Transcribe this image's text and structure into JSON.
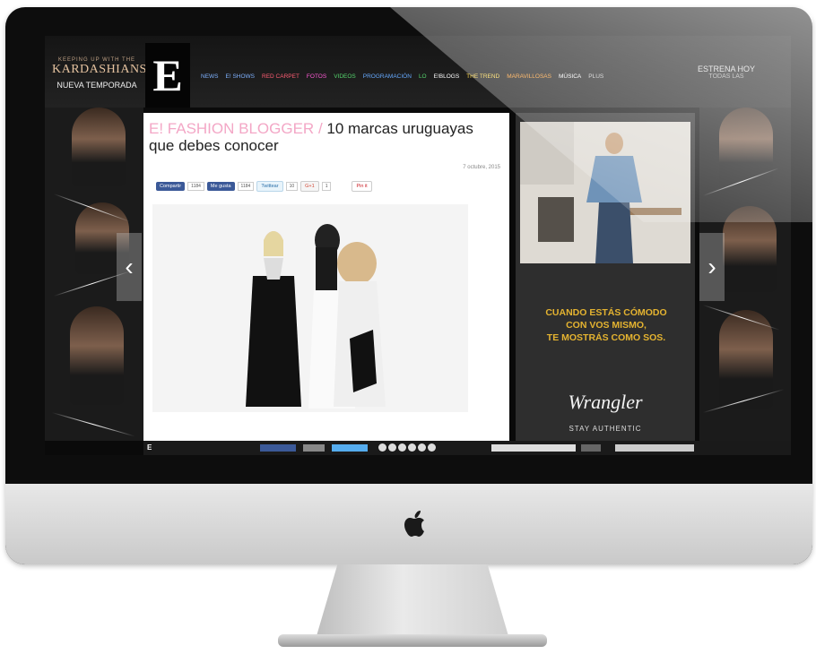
{
  "show": {
    "topline": "KEEPING UP WITH THE",
    "name": "KARDASHIANS",
    "season": "NUEVA TEMPORADA"
  },
  "logo": "E",
  "nav": [
    {
      "label": "NEWS",
      "color": "#7fb2ff"
    },
    {
      "label": "E! SHOWS",
      "color": "#7fb2ff"
    },
    {
      "label": "RED CARPET",
      "color": "#ff5d73"
    },
    {
      "label": "FOTOS",
      "color": "#ff5ad5"
    },
    {
      "label": "VIDEOS",
      "color": "#55d46d"
    },
    {
      "label": "PROGRAMACIÓN",
      "color": "#66aaff"
    },
    {
      "label": "LO",
      "color": "#55d46d"
    },
    {
      "label": "E!BLOGS",
      "color": "#ffffff"
    },
    {
      "label": "THE TREND",
      "color": "#ffd84a"
    },
    {
      "label": "MARAVILLOSAS",
      "color": "#ff9d2e"
    },
    {
      "label": "MÚSICA",
      "color": "#ffffff"
    },
    {
      "label": "PLUS",
      "color": "#cccccc"
    }
  ],
  "estrena": {
    "line1": "ESTRENA HOY",
    "line2": "TODAS LAS"
  },
  "article": {
    "category": "E! FASHION BLOGGER",
    "sep": " / ",
    "title": "10 marcas uruguayas que debes conocer",
    "date": "7 octubre, 2015"
  },
  "share": {
    "fb_share": "Compartir",
    "fb_share_count": "1184",
    "fb_like": "Me gusta",
    "fb_like_count": "1184",
    "tw": "Twittear",
    "tw_count": "10",
    "gplus": "G+1",
    "gplus_count": "1",
    "pin": "Pin it"
  },
  "ad": {
    "line1": "CUANDO ESTÁS CÓMODO",
    "line2": "CON VOS MISMO,",
    "line3": "TE MOSTRÁS COMO SOS.",
    "brand": "Wrangler",
    "tagline": "STAY AUTHENTIC"
  },
  "arrows": {
    "left": "‹",
    "right": "›"
  },
  "colors": {
    "category_pink": "#f3a7c6",
    "fb_blue": "#3b5998",
    "tw_blue": "#55acee",
    "ad_gold": "#e4b330"
  }
}
